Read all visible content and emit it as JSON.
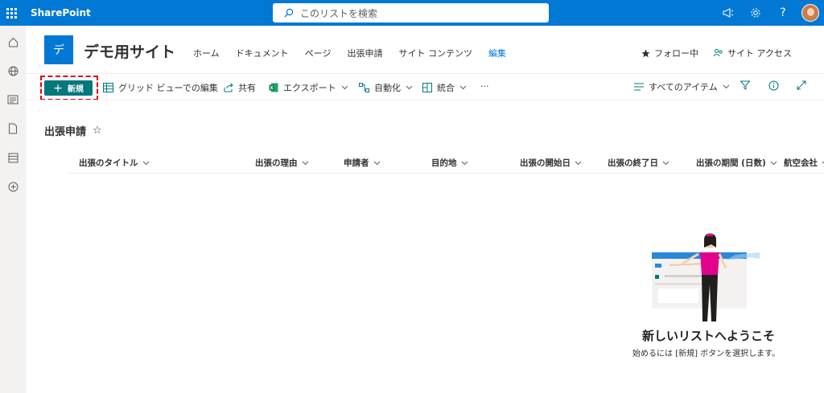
{
  "suitebar": {
    "brand": "SharePoint",
    "search_placeholder": "このリストを検索",
    "help_label": "?"
  },
  "site": {
    "logo_letter": "デ",
    "title": "デモ用サイト",
    "nav": [
      "ホーム",
      "ドキュメント",
      "ページ",
      "出張申請",
      "サイト コンテンツ"
    ],
    "edit_label": "編集",
    "follow_label": "フォロー中",
    "access_label": "サイト アクセス"
  },
  "commands": {
    "new_label": "新規",
    "grid_label": "グリッド ビューでの編集",
    "share_label": "共有",
    "export_label": "エクスポート",
    "automate_label": "自動化",
    "integrate_label": "統合",
    "more_label": "···",
    "view_label": "すべてのアイテム"
  },
  "list": {
    "title": "出張申請",
    "star": "☆",
    "columns": [
      "出張のタイトル",
      "出張の理由",
      "申請者",
      "目的地",
      "出張の開始日",
      "出張の終了日",
      "出張の期間 (日数)",
      "航空会社"
    ]
  },
  "empty_state": {
    "title": "新しいリストへようこそ",
    "subtitle": "始めるには [新規] ボタンを選択します。"
  },
  "colors": {
    "suitebar": "#0078d4",
    "accent": "#03787c",
    "highlight": "#e00000"
  }
}
